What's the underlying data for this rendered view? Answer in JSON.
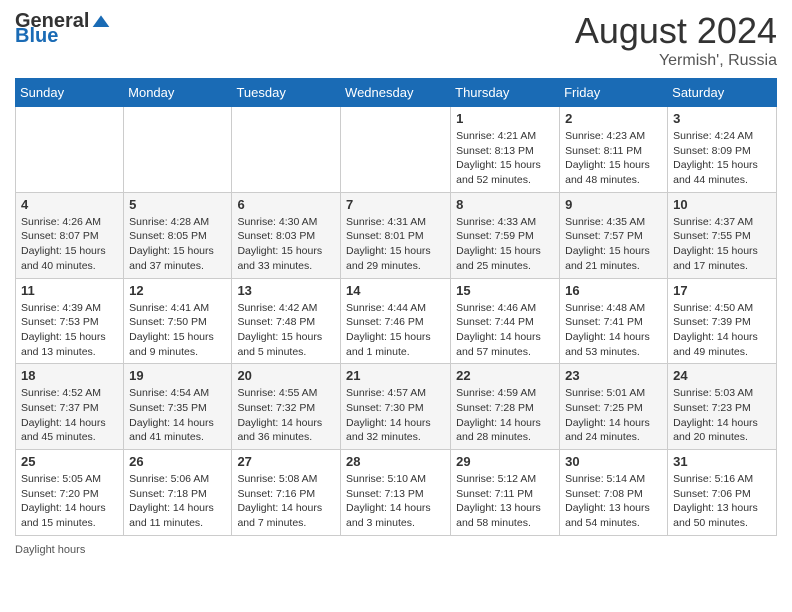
{
  "header": {
    "logo_general": "General",
    "logo_blue": "Blue",
    "month_year": "August 2024",
    "location": "Yermish', Russia"
  },
  "footer": {
    "daylight_label": "Daylight hours"
  },
  "days_of_week": [
    "Sunday",
    "Monday",
    "Tuesday",
    "Wednesday",
    "Thursday",
    "Friday",
    "Saturday"
  ],
  "weeks": [
    [
      {
        "day": "",
        "info": ""
      },
      {
        "day": "",
        "info": ""
      },
      {
        "day": "",
        "info": ""
      },
      {
        "day": "",
        "info": ""
      },
      {
        "day": "1",
        "info": "Sunrise: 4:21 AM\nSunset: 8:13 PM\nDaylight: 15 hours and 52 minutes."
      },
      {
        "day": "2",
        "info": "Sunrise: 4:23 AM\nSunset: 8:11 PM\nDaylight: 15 hours and 48 minutes."
      },
      {
        "day": "3",
        "info": "Sunrise: 4:24 AM\nSunset: 8:09 PM\nDaylight: 15 hours and 44 minutes."
      }
    ],
    [
      {
        "day": "4",
        "info": "Sunrise: 4:26 AM\nSunset: 8:07 PM\nDaylight: 15 hours and 40 minutes."
      },
      {
        "day": "5",
        "info": "Sunrise: 4:28 AM\nSunset: 8:05 PM\nDaylight: 15 hours and 37 minutes."
      },
      {
        "day": "6",
        "info": "Sunrise: 4:30 AM\nSunset: 8:03 PM\nDaylight: 15 hours and 33 minutes."
      },
      {
        "day": "7",
        "info": "Sunrise: 4:31 AM\nSunset: 8:01 PM\nDaylight: 15 hours and 29 minutes."
      },
      {
        "day": "8",
        "info": "Sunrise: 4:33 AM\nSunset: 7:59 PM\nDaylight: 15 hours and 25 minutes."
      },
      {
        "day": "9",
        "info": "Sunrise: 4:35 AM\nSunset: 7:57 PM\nDaylight: 15 hours and 21 minutes."
      },
      {
        "day": "10",
        "info": "Sunrise: 4:37 AM\nSunset: 7:55 PM\nDaylight: 15 hours and 17 minutes."
      }
    ],
    [
      {
        "day": "11",
        "info": "Sunrise: 4:39 AM\nSunset: 7:53 PM\nDaylight: 15 hours and 13 minutes."
      },
      {
        "day": "12",
        "info": "Sunrise: 4:41 AM\nSunset: 7:50 PM\nDaylight: 15 hours and 9 minutes."
      },
      {
        "day": "13",
        "info": "Sunrise: 4:42 AM\nSunset: 7:48 PM\nDaylight: 15 hours and 5 minutes."
      },
      {
        "day": "14",
        "info": "Sunrise: 4:44 AM\nSunset: 7:46 PM\nDaylight: 15 hours and 1 minute."
      },
      {
        "day": "15",
        "info": "Sunrise: 4:46 AM\nSunset: 7:44 PM\nDaylight: 14 hours and 57 minutes."
      },
      {
        "day": "16",
        "info": "Sunrise: 4:48 AM\nSunset: 7:41 PM\nDaylight: 14 hours and 53 minutes."
      },
      {
        "day": "17",
        "info": "Sunrise: 4:50 AM\nSunset: 7:39 PM\nDaylight: 14 hours and 49 minutes."
      }
    ],
    [
      {
        "day": "18",
        "info": "Sunrise: 4:52 AM\nSunset: 7:37 PM\nDaylight: 14 hours and 45 minutes."
      },
      {
        "day": "19",
        "info": "Sunrise: 4:54 AM\nSunset: 7:35 PM\nDaylight: 14 hours and 41 minutes."
      },
      {
        "day": "20",
        "info": "Sunrise: 4:55 AM\nSunset: 7:32 PM\nDaylight: 14 hours and 36 minutes."
      },
      {
        "day": "21",
        "info": "Sunrise: 4:57 AM\nSunset: 7:30 PM\nDaylight: 14 hours and 32 minutes."
      },
      {
        "day": "22",
        "info": "Sunrise: 4:59 AM\nSunset: 7:28 PM\nDaylight: 14 hours and 28 minutes."
      },
      {
        "day": "23",
        "info": "Sunrise: 5:01 AM\nSunset: 7:25 PM\nDaylight: 14 hours and 24 minutes."
      },
      {
        "day": "24",
        "info": "Sunrise: 5:03 AM\nSunset: 7:23 PM\nDaylight: 14 hours and 20 minutes."
      }
    ],
    [
      {
        "day": "25",
        "info": "Sunrise: 5:05 AM\nSunset: 7:20 PM\nDaylight: 14 hours and 15 minutes."
      },
      {
        "day": "26",
        "info": "Sunrise: 5:06 AM\nSunset: 7:18 PM\nDaylight: 14 hours and 11 minutes."
      },
      {
        "day": "27",
        "info": "Sunrise: 5:08 AM\nSunset: 7:16 PM\nDaylight: 14 hours and 7 minutes."
      },
      {
        "day": "28",
        "info": "Sunrise: 5:10 AM\nSunset: 7:13 PM\nDaylight: 14 hours and 3 minutes."
      },
      {
        "day": "29",
        "info": "Sunrise: 5:12 AM\nSunset: 7:11 PM\nDaylight: 13 hours and 58 minutes."
      },
      {
        "day": "30",
        "info": "Sunrise: 5:14 AM\nSunset: 7:08 PM\nDaylight: 13 hours and 54 minutes."
      },
      {
        "day": "31",
        "info": "Sunrise: 5:16 AM\nSunset: 7:06 PM\nDaylight: 13 hours and 50 minutes."
      }
    ]
  ]
}
